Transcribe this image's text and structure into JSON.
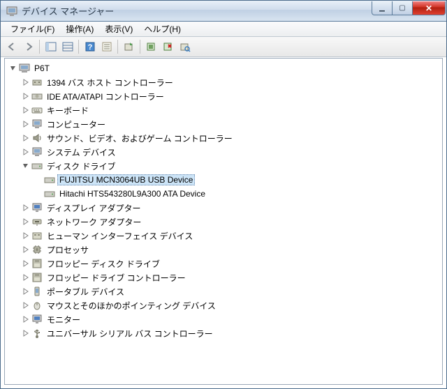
{
  "window": {
    "title": "デバイス マネージャー"
  },
  "menu": {
    "file": "ファイル(F)",
    "action": "操作(A)",
    "view": "表示(V)",
    "help": "ヘルプ(H)"
  },
  "tree": {
    "root": "P6T",
    "nodes": {
      "bus1394": "1394 バス ホスト コントローラー",
      "ide": "IDE ATA/ATAPI コントローラー",
      "keyboard": "キーボード",
      "computer": "コンピューター",
      "sound": "サウンド、ビデオ、およびゲーム コントローラー",
      "system": "システム デバイス",
      "disk": "ディスク ドライブ",
      "disk_fujitsu": "FUJITSU MCN3064UB USB Device",
      "disk_hitachi": "Hitachi HTS543280L9A300 ATA Device",
      "display": "ディスプレイ アダプター",
      "network": "ネットワーク アダプター",
      "hid": "ヒューマン インターフェイス デバイス",
      "processor": "プロセッサ",
      "floppy_drive": "フロッピー ディスク ドライブ",
      "floppy_ctrl": "フロッピー ドライブ コントローラー",
      "portable": "ポータブル デバイス",
      "mouse": "マウスとそのほかのポインティング デバイス",
      "monitor": "モニター",
      "usb": "ユニバーサル シリアル バス コントローラー"
    }
  }
}
